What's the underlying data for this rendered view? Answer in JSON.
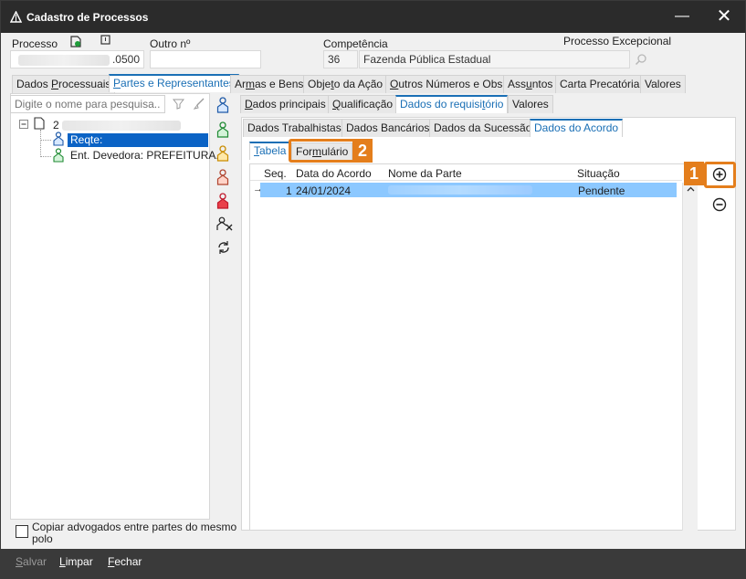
{
  "window": {
    "title": "Cadastro de Processos"
  },
  "header": {
    "processo_label": "Processo",
    "processo_value": ".0500",
    "outro_label": "Outro nº",
    "outro_value": "",
    "competencia_label": "Competência",
    "competencia_code": "36",
    "competencia_name": "Fazenda Pública Estadual",
    "excepcional_label": "Processo Excepcional"
  },
  "main_tabs": [
    {
      "label": "Dados Processuais"
    },
    {
      "label": "Partes e Representantes"
    },
    {
      "label": "Armas e Bens"
    },
    {
      "label": "Objeto da Ação"
    },
    {
      "label": "Outros Números e Obs."
    },
    {
      "label": "Assuntos"
    },
    {
      "label": "Carta Precatória"
    },
    {
      "label": "Valores"
    }
  ],
  "left_panel": {
    "search_placeholder": "Digite o nome para pesquisa...",
    "tree_root": "2",
    "tree_selected": "Reqte:",
    "tree_item2": "Ent. Devedora: PREFEITURA..."
  },
  "sub_tabs": [
    {
      "label": "Dados principais"
    },
    {
      "label": "Qualificação"
    },
    {
      "label": "Dados do requisitório"
    },
    {
      "label": "Valores"
    }
  ],
  "sub_tabs2": [
    {
      "label": "Dados Trabalhistas"
    },
    {
      "label": "Dados Bancários"
    },
    {
      "label": "Dados da Sucessão"
    },
    {
      "label": "Dados do Acordo"
    }
  ],
  "view_tabs": [
    {
      "label": "Tabela"
    },
    {
      "label": "Formulário"
    }
  ],
  "grid": {
    "columns": [
      "Seq.",
      "Data do Acordo",
      "Nome da Parte",
      "Situação"
    ],
    "rows": [
      {
        "seq": "1",
        "data": "24/01/2024",
        "nome": "",
        "situacao": "Pendente"
      }
    ]
  },
  "annotations": {
    "badge1": "1",
    "badge2": "2"
  },
  "copy_checkbox_label": "Copiar advogados entre partes do mesmo polo",
  "footer": {
    "salvar": "Salvar",
    "limpar": "Limpar",
    "fechar": "Fechar"
  },
  "colors": {
    "accent": "#1a6fb5",
    "highlight": "#e47e1c",
    "selection": "#0b63c5",
    "row_selection": "#8cc8ff"
  }
}
